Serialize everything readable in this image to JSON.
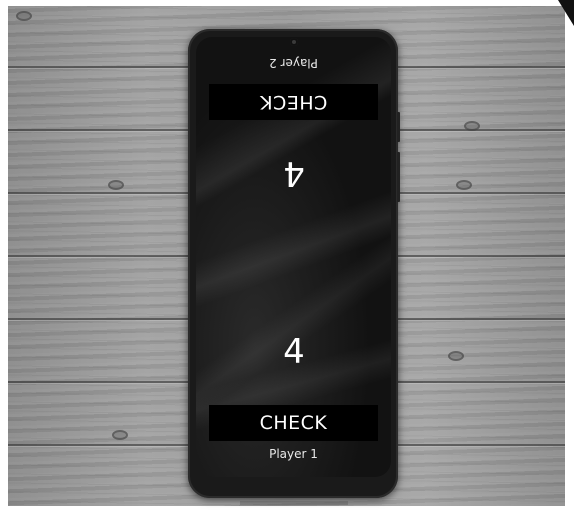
{
  "player2": {
    "label": "Player 2",
    "check_label": "CHECK",
    "count": "4"
  },
  "player1": {
    "label": "Player 1",
    "check_label": "CHECK",
    "count": "4"
  },
  "colors": {
    "button_bg": "#000000",
    "text": "#ffffff",
    "screen_bg": "#151515",
    "wood": "#9a9a9a"
  }
}
